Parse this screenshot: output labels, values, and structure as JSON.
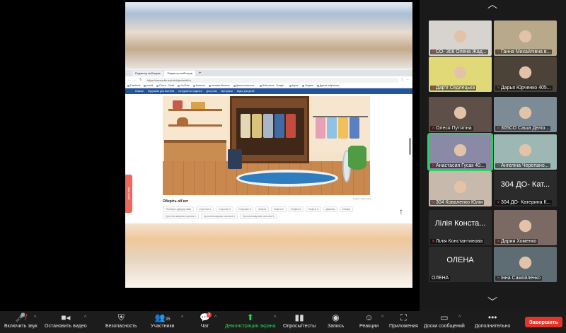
{
  "browser": {
    "tabs": [
      {
        "label": "Редактор вебінарів"
      },
      {
        "label": "Редактор вебінарів"
      }
    ],
    "new_tab": "+",
    "url": "https://wezoolla.ua/ru/object/edit/ru",
    "bookmarks": [
      "Facebook",
      "postol",
      "Почта - Gmail",
      "YouTube",
      "Новости",
      "Іноземні Шинели",
      "Дочка психолога...",
      "Мой рынок - Google...",
      "Курсы",
      "Защита",
      "Другие избранное"
    ],
    "site_nav": [
      "Новини",
      "Підтримка для вчителів",
      "Інструменти педагога",
      "Для учнів",
      "Матеріали",
      "Відео для дітей"
    ]
  },
  "scene": {
    "side_tab": "Шкільний",
    "caption": "Рядок з картинкою",
    "choose_title": "Оберіть об'єкт",
    "chips": [
      "Полиця з дверцятами",
      "Сорочка 1",
      "Сорочка 2",
      "Сорочка 3",
      "Кофта",
      "Кофта 2",
      "Кофта 3",
      "Кофта 4",
      "Джинси",
      "Шафа",
      "Кухонна жарова тарілка 1",
      "Кухонна жарова частина 1",
      "Кухонна жарова частина 2"
    ],
    "scroll_arrow": "↑"
  },
  "participants": [
    {
      "name": "СО- 308 Олена Жад...",
      "color": "#d7d3cf",
      "muted": true
    },
    {
      "name": "Ганна Михайлівна в...",
      "color": "#b7a98a",
      "muted": true
    },
    {
      "name": "Дар'я Седлецька",
      "color": "#e1d978",
      "muted": true
    },
    {
      "name": "Дарья Юрченко 405...",
      "color": "#4c4338",
      "muted": true
    },
    {
      "name": "Олеся Путятіна",
      "color": "#5e5048",
      "muted": true
    },
    {
      "name": "305СО Саша Деліо...",
      "color": "#7c8b96",
      "muted": true
    },
    {
      "name": "Анастасия Гусак 40...",
      "color": "#8a8aa6",
      "muted": true,
      "highlight": true
    },
    {
      "name": "Ангеліна Черепано...",
      "color": "#9db7b4",
      "muted": true
    },
    {
      "name": "304 Коваленко Юлія",
      "color": "#c7b9ac",
      "muted": true
    },
    {
      "name": "304 ДО- Катерина К...",
      "color": "#2e2e2e",
      "muted": true,
      "big": "304 ДО- Кат..."
    },
    {
      "name": "Лілія Константинова",
      "color": "#2e2e2e",
      "muted": true,
      "big": "Лілія Конста..."
    },
    {
      "name": "Дария Хоменко",
      "color": "#7b6a64",
      "muted": true
    },
    {
      "name": "ОЛЕНА",
      "color": "#2e2e2e",
      "muted": false,
      "big": "ОЛЕНА"
    },
    {
      "name": "Інна Самойленко",
      "color": "#5e6c73",
      "muted": true
    }
  ],
  "toolbar": {
    "mute": {
      "label": "Включить звук",
      "icon": "mic-muted-icon"
    },
    "video": {
      "label": "Остановить видео",
      "icon": "camera-icon"
    },
    "security": {
      "label": "Безопасность",
      "icon": "shield-icon"
    },
    "participants": {
      "label": "Участники",
      "icon": "people-icon",
      "count": "35"
    },
    "chat": {
      "label": "Чат",
      "icon": "chat-icon",
      "badge": "3"
    },
    "share": {
      "label": "Демонстрация экрана",
      "icon": "share-screen-icon",
      "color": "#23d959"
    },
    "polls": {
      "label": "Опросы/тесты",
      "icon": "poll-icon"
    },
    "record": {
      "label": "Запись",
      "icon": "record-icon"
    },
    "reactions": {
      "label": "Реакции",
      "icon": "smile-icon"
    },
    "apps": {
      "label": "Приложения",
      "icon": "apps-icon"
    },
    "whiteboards": {
      "label": "Доски сообщений",
      "icon": "whiteboard-icon"
    },
    "more": {
      "label": "Дополнительно",
      "icon": "more-icon"
    },
    "end": {
      "label": "Завершить",
      "color": "#e0352b"
    }
  }
}
